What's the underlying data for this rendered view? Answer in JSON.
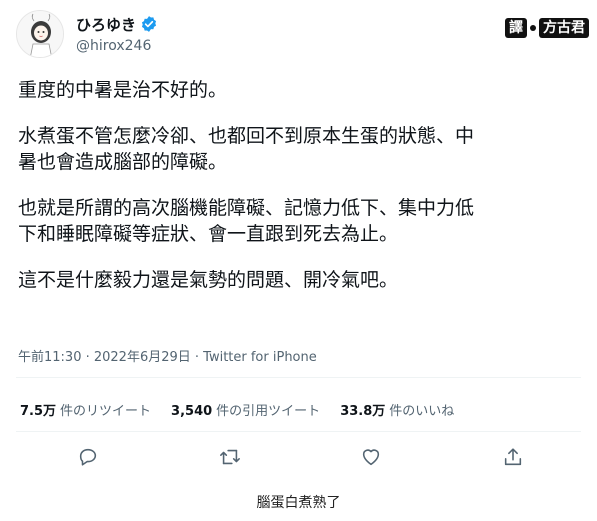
{
  "user": {
    "display_name": "ひろゆき",
    "handle": "@hirox246",
    "avatar": "avatar-illustration",
    "verified_icon": "verified-badge-icon"
  },
  "watermark": {
    "left": "譯",
    "right": "方古君"
  },
  "tweet": {
    "paragraphs": [
      "重度的中暑是治不好的。",
      "水煮蛋不管怎麼冷卻、也都回不到原本生蛋的狀態、中\n暑也會造成腦部的障礙。",
      "也就是所謂的高次腦機能障礙、記憶力低下、集中力低\n下和睡眠障礙等症狀、會一直跟到死去為止。",
      "這不是什麼毅力還是氣勢的問題、開冷氣吧。"
    ],
    "meta": "午前11:30 · 2022年6月29日 · Twitter for iPhone"
  },
  "stats": {
    "retweets_num": "7.5万",
    "retweets_label": "件のリツイート",
    "quotes_num": "3,540",
    "quotes_label": "件の引用ツイート",
    "likes_num": "33.8万",
    "likes_label": "件のいいね"
  },
  "actions": [
    "reply-icon",
    "retweet-icon",
    "like-icon",
    "share-icon"
  ],
  "caption": "腦蛋白煮熟了",
  "colors": {
    "text": "#0f1419",
    "secondary": "#536471",
    "verified": "#1d9bf0",
    "divider": "#eff3f4"
  }
}
